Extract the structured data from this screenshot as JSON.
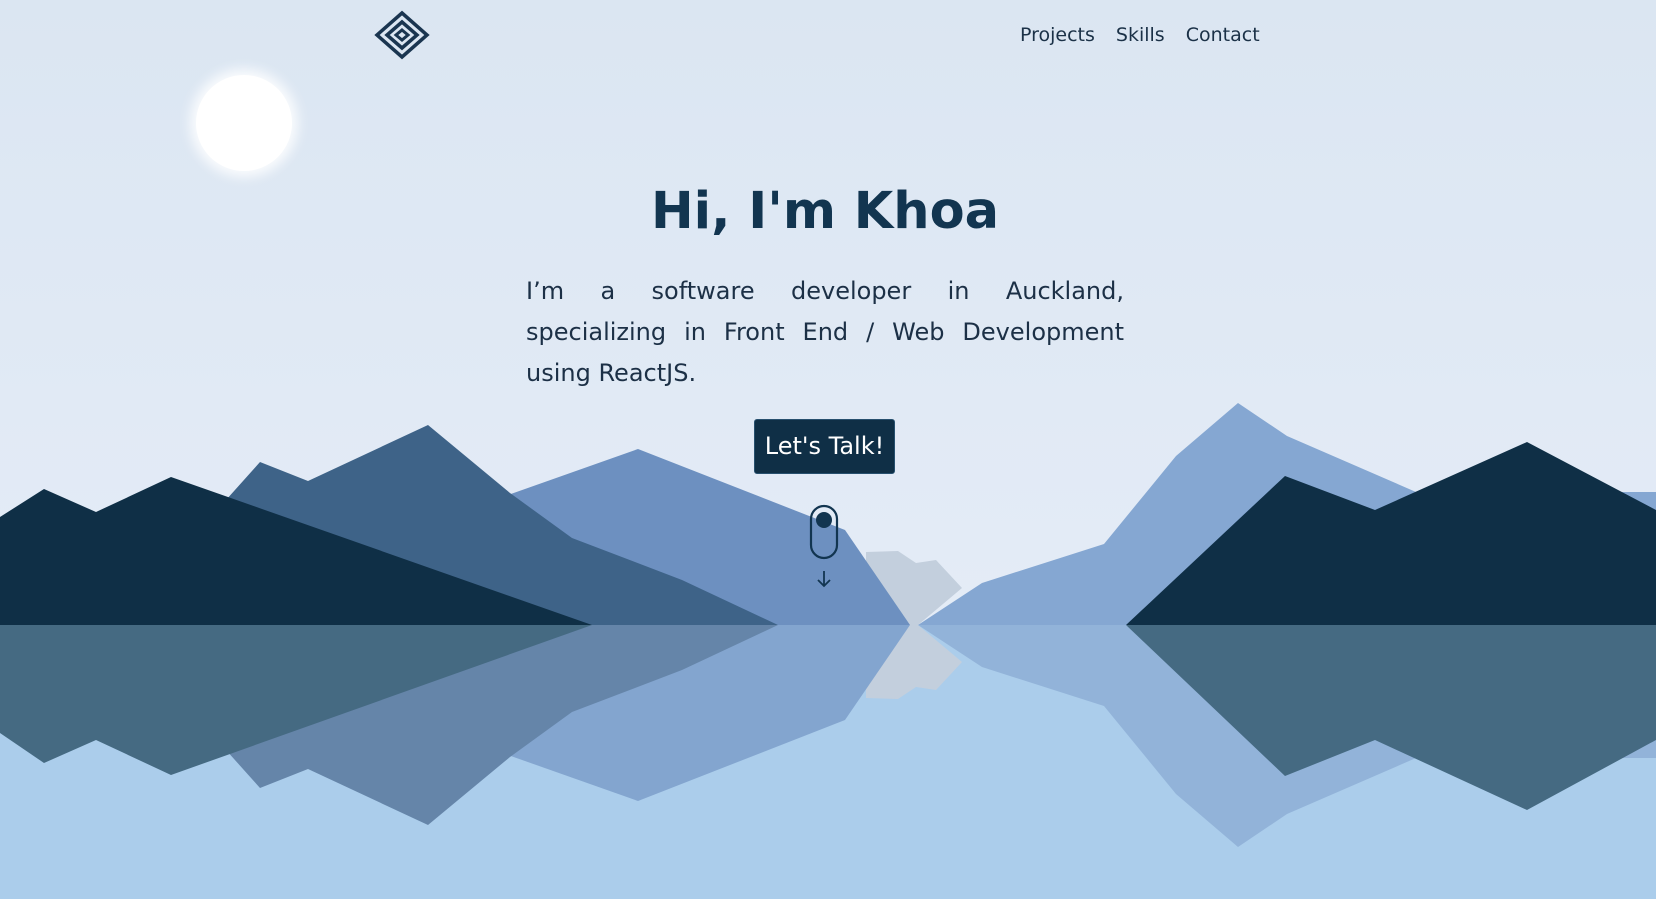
{
  "header": {
    "logo": "diamond-logo-icon",
    "nav": [
      {
        "label": "Projects"
      },
      {
        "label": "Skills"
      },
      {
        "label": "Contact"
      }
    ]
  },
  "hero": {
    "title": "Hi, I'm Khoa",
    "text": "I’m a software developer in Auckland, specializing in Front End / Web Development using ReactJS.",
    "cta_label": "Let's Talk!"
  },
  "decor": {
    "sun": "sun",
    "scroll_icon": "scroll-mouse-icon",
    "arrow_icon": "arrow-down-icon"
  },
  "colors": {
    "sky": "#dde7f3",
    "navy": "#0f2f46",
    "mid_blue": "#3e6388",
    "light_blue": "#6d90c0",
    "pale_blue": "#85a7d2",
    "grey_peak": "#c3cfdd",
    "water": "#abcdeb"
  }
}
